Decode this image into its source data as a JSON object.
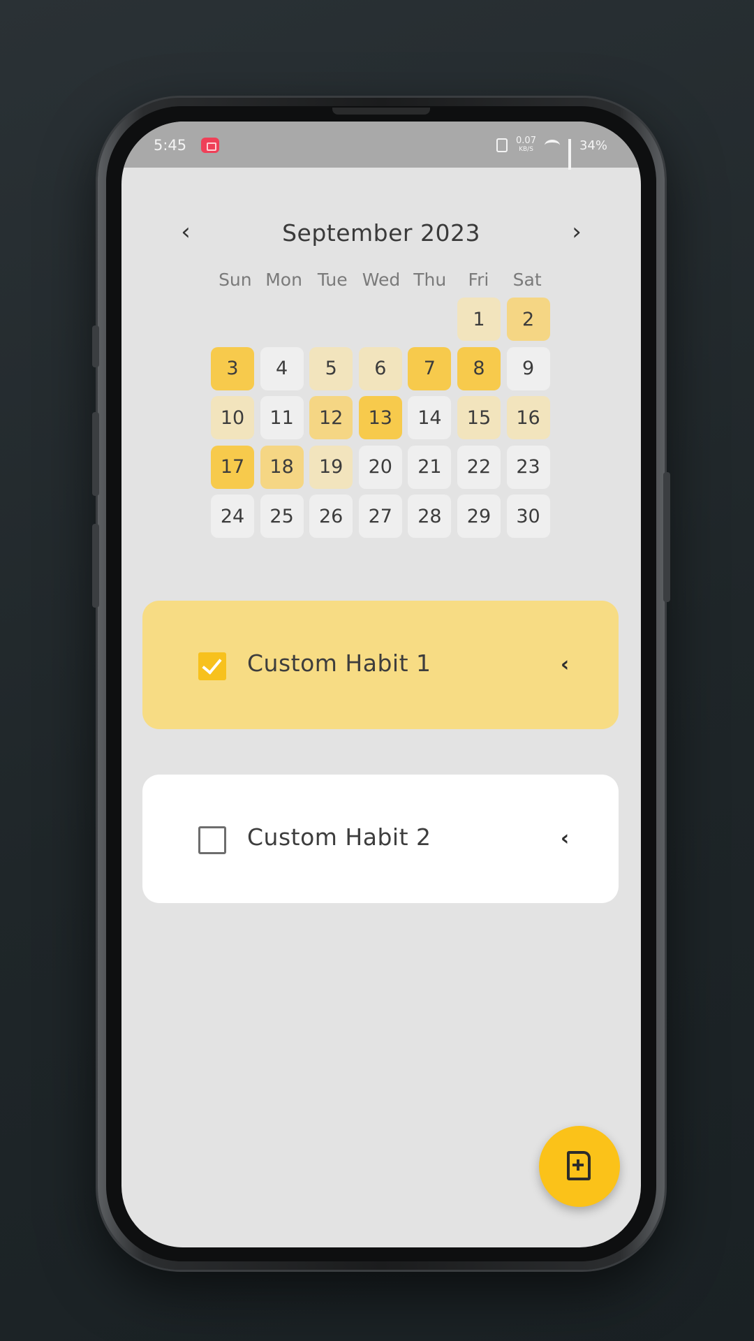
{
  "status_bar": {
    "time": "5:45",
    "net_rate_top": "0.07",
    "net_rate_bottom": "KB/S",
    "battery": "34%"
  },
  "calendar": {
    "month_title": "September 2023",
    "prev_label": "‹",
    "next_label": "›",
    "weekdays": [
      "Sun",
      "Mon",
      "Tue",
      "Wed",
      "Thu",
      "Fri",
      "Sat"
    ],
    "leading_blank_days": 5,
    "days": [
      {
        "day": "1",
        "level": 1
      },
      {
        "day": "2",
        "level": 2
      },
      {
        "day": "3",
        "level": 3
      },
      {
        "day": "4",
        "level": 0
      },
      {
        "day": "5",
        "level": 1
      },
      {
        "day": "6",
        "level": 1
      },
      {
        "day": "7",
        "level": 3
      },
      {
        "day": "8",
        "level": 3
      },
      {
        "day": "9",
        "level": 0
      },
      {
        "day": "10",
        "level": 1
      },
      {
        "day": "11",
        "level": 0
      },
      {
        "day": "12",
        "level": 2
      },
      {
        "day": "13",
        "level": 3
      },
      {
        "day": "14",
        "level": 0
      },
      {
        "day": "15",
        "level": 1
      },
      {
        "day": "16",
        "level": 1
      },
      {
        "day": "17",
        "level": 3
      },
      {
        "day": "18",
        "level": 2
      },
      {
        "day": "19",
        "level": 1
      },
      {
        "day": "20",
        "level": 0
      },
      {
        "day": "21",
        "level": 0
      },
      {
        "day": "22",
        "level": 0
      },
      {
        "day": "23",
        "level": 0
      },
      {
        "day": "24",
        "level": 0
      },
      {
        "day": "25",
        "level": 0
      },
      {
        "day": "26",
        "level": 0
      },
      {
        "day": "27",
        "level": 0
      },
      {
        "day": "28",
        "level": 0
      },
      {
        "day": "29",
        "level": 0
      },
      {
        "day": "30",
        "level": 0
      }
    ]
  },
  "habits": [
    {
      "label": "Custom Habit 1",
      "checked": true
    },
    {
      "label": "Custom Habit 2",
      "checked": false
    }
  ],
  "colors": {
    "accent": "#f7c11d",
    "habit_done_card": "#f7dc84",
    "habit_card": "#ffffff",
    "screen_bg": "#e3e3e3"
  },
  "icons": {
    "fab": "add-file-icon",
    "expand": "chevron-left-icon"
  }
}
